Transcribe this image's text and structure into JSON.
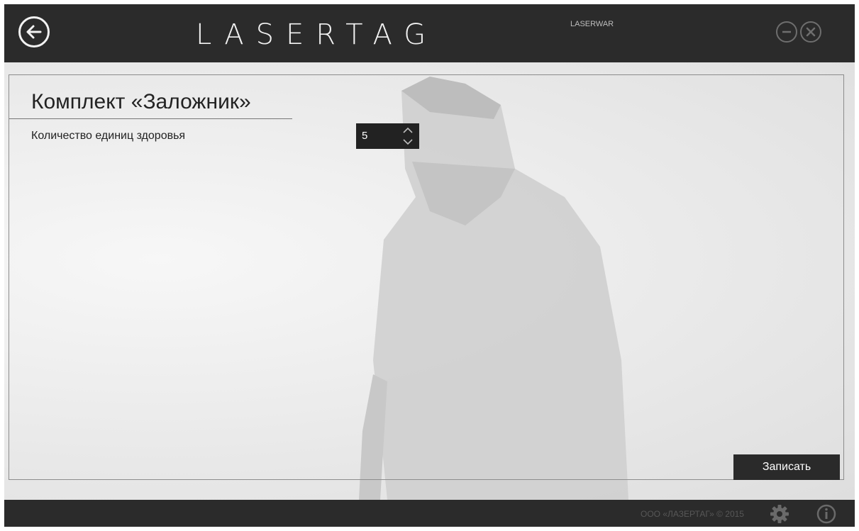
{
  "titlebar": {
    "logo_text": "LASERTAG",
    "logo_subtext": "LASERWAR",
    "back_icon": "arrow-left-circle-icon",
    "minimize_icon": "minus-circle-icon",
    "close_icon": "x-circle-icon"
  },
  "main": {
    "title": "Комплект «Заложник»",
    "health_label": "Количество единиц здоровья",
    "health_value": "5",
    "save_label": "Записать"
  },
  "footer": {
    "copyright": "ООО «ЛАЗЕРТАГ» © 2015",
    "settings_icon": "gear-icon",
    "info_icon": "info-icon"
  },
  "colors": {
    "bar": "#2b2b2b",
    "field_bg": "#222222",
    "accent_text": "#ffffff"
  }
}
